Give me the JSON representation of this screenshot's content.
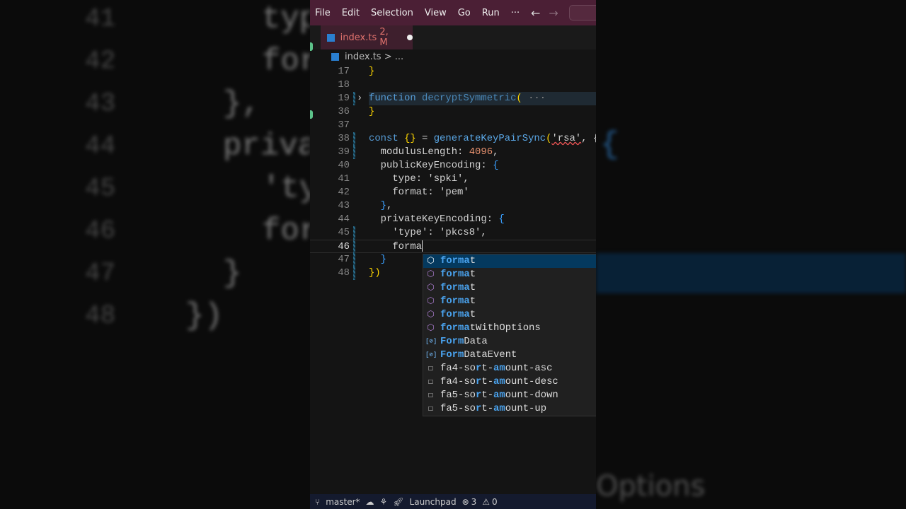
{
  "background": {
    "left_line_numbers": [
      "41",
      "42",
      "43",
      "44",
      "45",
      "46",
      "47",
      "48"
    ],
    "left_code": [
      "typ",
      "for",
      "},",
      "priva",
      "'ty",
      "for",
      "}",
      "})"
    ],
    "right_text": "Options"
  },
  "menu": [
    "File",
    "Edit",
    "Selection",
    "View",
    "Go",
    "Run",
    "···"
  ],
  "nav": {
    "back": "←",
    "forward": "→"
  },
  "tab": {
    "label": "index.ts",
    "badge": "2, M",
    "dirty": true
  },
  "breadcrumb": {
    "file": "index.ts",
    "sep": ">",
    "rest": "..."
  },
  "code": [
    {
      "n": "17",
      "tokens": [
        [
          "}",
          "b1"
        ]
      ]
    },
    {
      "n": "18",
      "tokens": []
    },
    {
      "n": "19",
      "folded": true,
      "tokens": [
        [
          "function ",
          "kw"
        ],
        [
          "decryptSymmetric",
          "fnd"
        ],
        [
          "(",
          "b1"
        ],
        [
          " ···",
          "el"
        ]
      ]
    },
    {
      "n": "36",
      "tokens": [
        [
          "}",
          "b1"
        ]
      ]
    },
    {
      "n": "37",
      "tokens": []
    },
    {
      "n": "38",
      "tokens": [
        [
          "const ",
          "kw"
        ],
        [
          "{}",
          "b1"
        ],
        [
          " = ",
          "pu"
        ],
        [
          "generateKeyPairSync",
          "fn"
        ],
        [
          "(",
          "b1"
        ],
        [
          "'rsa'",
          "st squig"
        ],
        [
          ", {",
          "pu"
        ]
      ]
    },
    {
      "n": "39",
      "tokens": [
        [
          "  modulusLength",
          "pr"
        ],
        [
          ": ",
          "pu"
        ],
        [
          "4096",
          "nm"
        ],
        [
          ",",
          "pu"
        ]
      ]
    },
    {
      "n": "40",
      "tokens": [
        [
          "  publicKeyEncoding",
          "pr"
        ],
        [
          ": ",
          "pu"
        ],
        [
          "{",
          "b2"
        ]
      ]
    },
    {
      "n": "41",
      "tokens": [
        [
          "    type",
          "pr"
        ],
        [
          ": ",
          "pu"
        ],
        [
          "'spki'",
          "st"
        ],
        [
          ",",
          "pu"
        ]
      ]
    },
    {
      "n": "42",
      "tokens": [
        [
          "    format",
          "pr"
        ],
        [
          ": ",
          "pu"
        ],
        [
          "'pem'",
          "st"
        ]
      ]
    },
    {
      "n": "43",
      "tokens": [
        [
          "  }",
          "b2"
        ],
        [
          ",",
          "pu"
        ]
      ]
    },
    {
      "n": "44",
      "tokens": [
        [
          "  privateKeyEncoding",
          "pr"
        ],
        [
          ": ",
          "pu"
        ],
        [
          "{",
          "b2"
        ]
      ]
    },
    {
      "n": "45",
      "tokens": [
        [
          "    'type'",
          "st"
        ],
        [
          ": ",
          "pu"
        ],
        [
          "'pkcs8'",
          "st"
        ],
        [
          ",",
          "pu"
        ]
      ]
    },
    {
      "n": "46",
      "current": true,
      "tokens": [
        [
          "    forma",
          "pr"
        ]
      ]
    },
    {
      "n": "47",
      "tokens": [
        [
          "  }",
          "b2"
        ]
      ]
    },
    {
      "n": "48",
      "tokens": [
        [
          "}",
          "b1"
        ],
        [
          ")",
          "b1"
        ]
      ]
    }
  ],
  "suggestions": [
    {
      "kind": "property",
      "match": "forma",
      "rest": "t",
      "selected": true
    },
    {
      "kind": "property",
      "match": "forma",
      "rest": "t"
    },
    {
      "kind": "property",
      "match": "forma",
      "rest": "t"
    },
    {
      "kind": "property",
      "match": "forma",
      "rest": "t"
    },
    {
      "kind": "property",
      "match": "forma",
      "rest": "t"
    },
    {
      "kind": "property",
      "match": "forma",
      "rest": "tWithOptions"
    },
    {
      "kind": "variable",
      "match": "Form",
      "rest": "Data"
    },
    {
      "kind": "variable",
      "match": "Form",
      "rest": "DataEvent"
    },
    {
      "kind": "text",
      "parts": [
        [
          "f",
          ""
        ],
        [
          "a4-so",
          ""
        ],
        [
          "r",
          "m"
        ],
        [
          "t-",
          ""
        ],
        [
          "am",
          "m"
        ],
        [
          "ount-asc",
          ""
        ]
      ]
    },
    {
      "kind": "text",
      "parts": [
        [
          "f",
          ""
        ],
        [
          "a4-so",
          ""
        ],
        [
          "r",
          "m"
        ],
        [
          "t-",
          ""
        ],
        [
          "am",
          "m"
        ],
        [
          "ount-desc",
          ""
        ]
      ]
    },
    {
      "kind": "text",
      "parts": [
        [
          "f",
          ""
        ],
        [
          "a5-so",
          ""
        ],
        [
          "r",
          "m"
        ],
        [
          "t-",
          ""
        ],
        [
          "am",
          "m"
        ],
        [
          "ount-down",
          ""
        ]
      ]
    },
    {
      "kind": "text",
      "parts": [
        [
          "f",
          ""
        ],
        [
          "a5-so",
          ""
        ],
        [
          "r",
          "m"
        ],
        [
          "t-",
          ""
        ],
        [
          "am",
          "m"
        ],
        [
          "ount-up",
          ""
        ]
      ]
    }
  ],
  "status": {
    "branch": "master*",
    "launchpad": "Launchpad",
    "errors": "3",
    "warnings": "0"
  }
}
